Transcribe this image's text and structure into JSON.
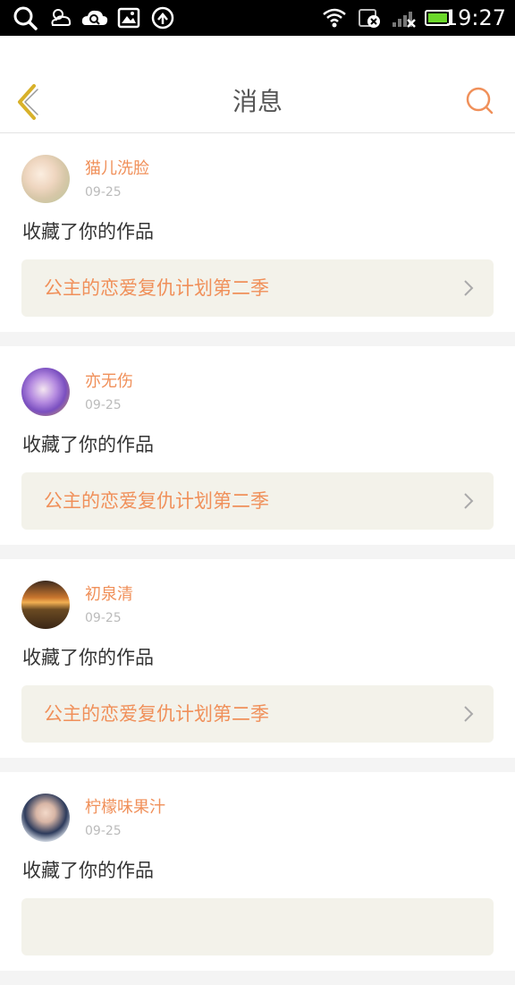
{
  "status_bar": {
    "time": "19:27",
    "left_icons": [
      "search-icon",
      "weather-icon",
      "cloud-search-icon",
      "gallery-icon",
      "sync-icon"
    ],
    "right_icons": [
      "wifi-icon",
      "no-sim-icon",
      "signal-icon",
      "battery-icon"
    ]
  },
  "header": {
    "title": "消息",
    "back_icon": "chevron-left-icon",
    "search_icon": "search-icon"
  },
  "colors": {
    "accent": "#f0905a",
    "back_chevron": "#d8b12a",
    "work_bg": "#f3f2ea"
  },
  "messages": [
    {
      "user": "猫儿洗脸",
      "date": "09-25",
      "action": "收藏了你的作品",
      "work": "公主的恋爱复仇计划第二季"
    },
    {
      "user": "亦无伤",
      "date": "09-25",
      "action": "收藏了你的作品",
      "work": "公主的恋爱复仇计划第二季"
    },
    {
      "user": "初泉清",
      "date": "09-25",
      "action": "收藏了你的作品",
      "work": "公主的恋爱复仇计划第二季"
    },
    {
      "user": "柠檬味果汁",
      "date": "09-25",
      "action": "收藏了你的作品",
      "work": ""
    }
  ]
}
